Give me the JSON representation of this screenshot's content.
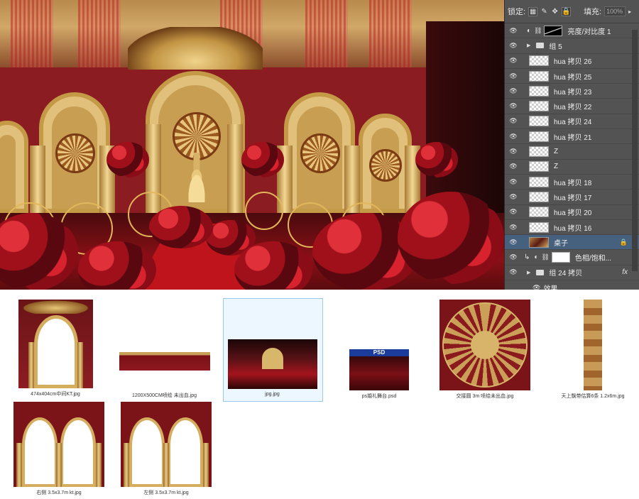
{
  "panel": {
    "lock_label": "锁定:",
    "fill_label": "填充:",
    "fill_value": "100%",
    "layers": [
      {
        "type": "adjust",
        "name": "亮度/对比度 1"
      },
      {
        "type": "group",
        "name": "组 5"
      },
      {
        "type": "layer",
        "name": "hua 拷贝 26"
      },
      {
        "type": "layer",
        "name": "hua 拷贝 25"
      },
      {
        "type": "layer",
        "name": "hua 拷贝 23"
      },
      {
        "type": "layer",
        "name": "hua 拷贝 22"
      },
      {
        "type": "layer",
        "name": "hua 拷贝 24"
      },
      {
        "type": "layer",
        "name": "hua 拷贝 21"
      },
      {
        "type": "layer",
        "name": "Z"
      },
      {
        "type": "layer",
        "name": "Z"
      },
      {
        "type": "layer",
        "name": "hua 拷贝 18"
      },
      {
        "type": "layer",
        "name": "hua 拷贝 17"
      },
      {
        "type": "layer",
        "name": "hua 拷贝 20"
      },
      {
        "type": "layer",
        "name": "hua 拷贝 16"
      },
      {
        "type": "layer",
        "name": "桌子",
        "selected": true
      },
      {
        "type": "adjust2",
        "name": "色相/饱和..."
      },
      {
        "type": "group",
        "name": "组 24 拷贝",
        "fx": "fx"
      },
      {
        "type": "effect",
        "name": "效果"
      }
    ]
  },
  "files": [
    {
      "caption": "474x404cm中间KT.jpg"
    },
    {
      "caption": "1200X500CM喷绘 未出血.jpg"
    },
    {
      "caption": "jpg.jpg"
    },
    {
      "caption": "ps婚礼舞台.psd",
      "badge": "PSD"
    },
    {
      "caption": "交接圆 3m 喷绘未出血.jpg"
    },
    {
      "caption": "天上飘带估算6条 1.2x6m.jpg"
    },
    {
      "caption": "右侧 3.5x3.7m kt.jpg"
    },
    {
      "caption": "左侧 3.5x3.7m kt.jpg"
    }
  ],
  "colors": {
    "panel_bg": "#535353",
    "selected_row": "#46617e",
    "wedding_red": "#8a1c22",
    "gold": "#e0c07a"
  }
}
